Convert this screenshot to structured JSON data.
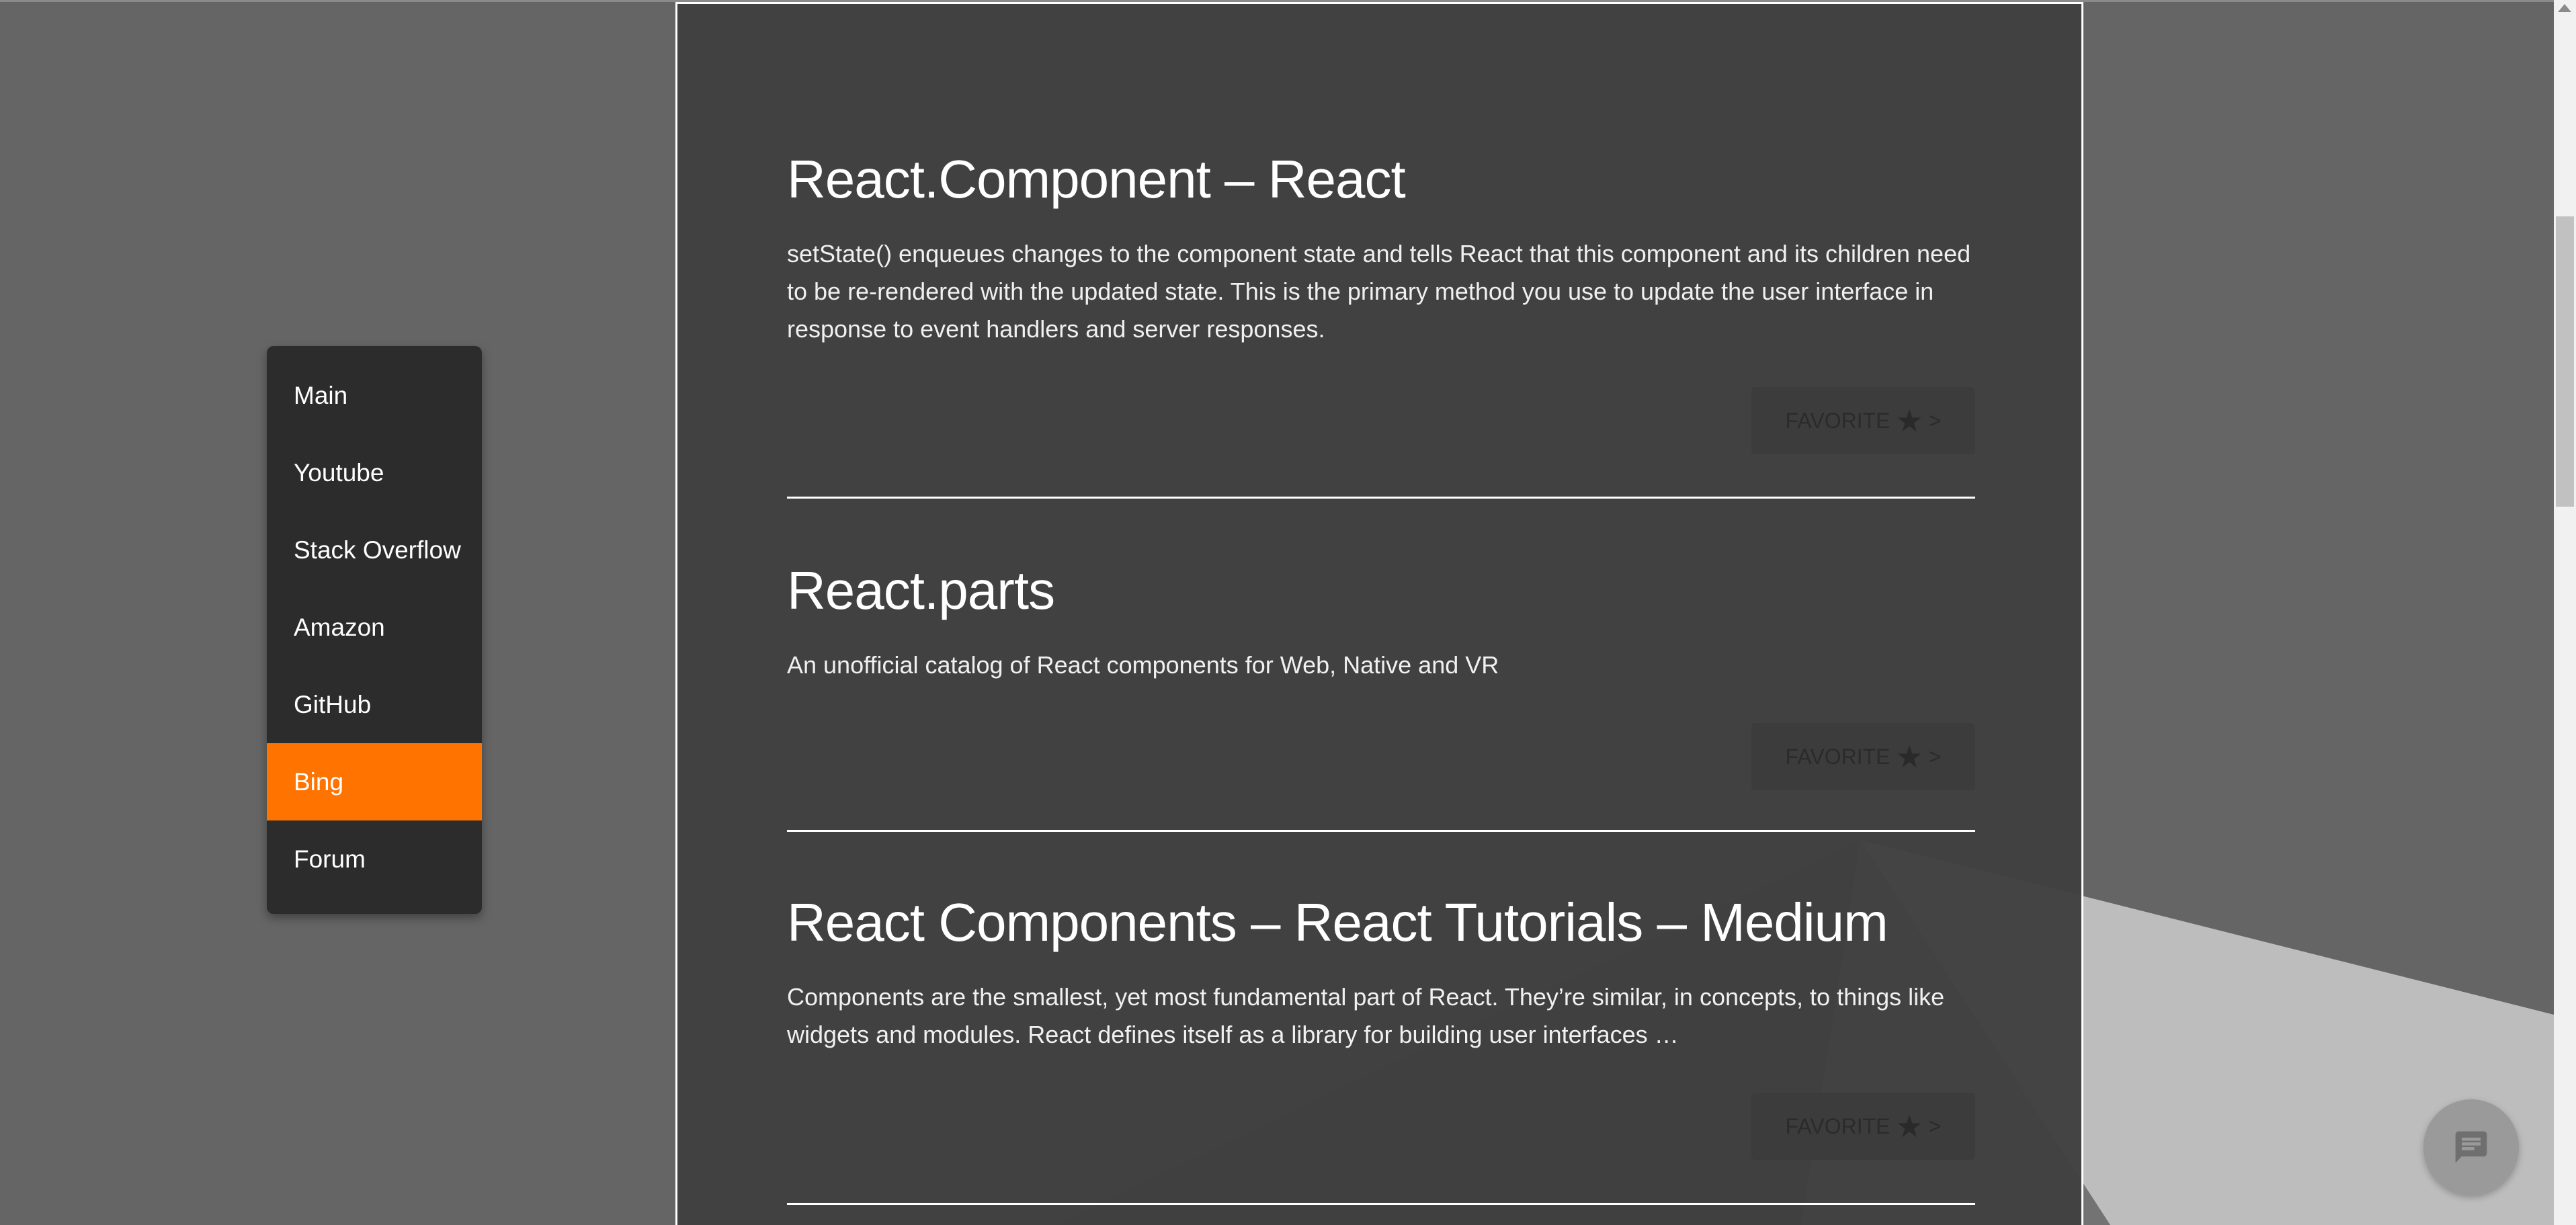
{
  "sidebar": {
    "items": [
      {
        "label": "Main"
      },
      {
        "label": "Youtube"
      },
      {
        "label": "Stack Overflow"
      },
      {
        "label": "Amazon"
      },
      {
        "label": "GitHub"
      },
      {
        "label": "Bing",
        "active": true
      },
      {
        "label": "Forum"
      }
    ]
  },
  "results": [
    {
      "title": "React.Component – React",
      "description": "setState() enqueues changes to the component state and tells React that this component and its children need to be re-rendered with the updated state. This is the primary method you use to update the user interface in response to event handlers and server responses.",
      "favorite_label": "FAVORITE",
      "favorite_arrow": ">"
    },
    {
      "title": "React.parts",
      "description": "An unofficial catalog of React components for Web, Native and VR",
      "favorite_label": "FAVORITE",
      "favorite_arrow": ">"
    },
    {
      "title": "React Components – React Tutorials – Medium",
      "description": "Components are the smallest, yet most fundamental part of React. They’re similar, in concepts, to things like widgets and modules. React defines itself as a library for building user interfaces …",
      "favorite_label": "FAVORITE",
      "favorite_arrow": ">"
    }
  ],
  "icons": {
    "favorite": "star-icon",
    "chat": "chat-icon",
    "scroll_up": "scroll-up-arrow-icon"
  },
  "colors": {
    "accent": "#ff7300",
    "background": "#656565",
    "panel": "#404040",
    "sidebar": "#2c2c2c"
  }
}
